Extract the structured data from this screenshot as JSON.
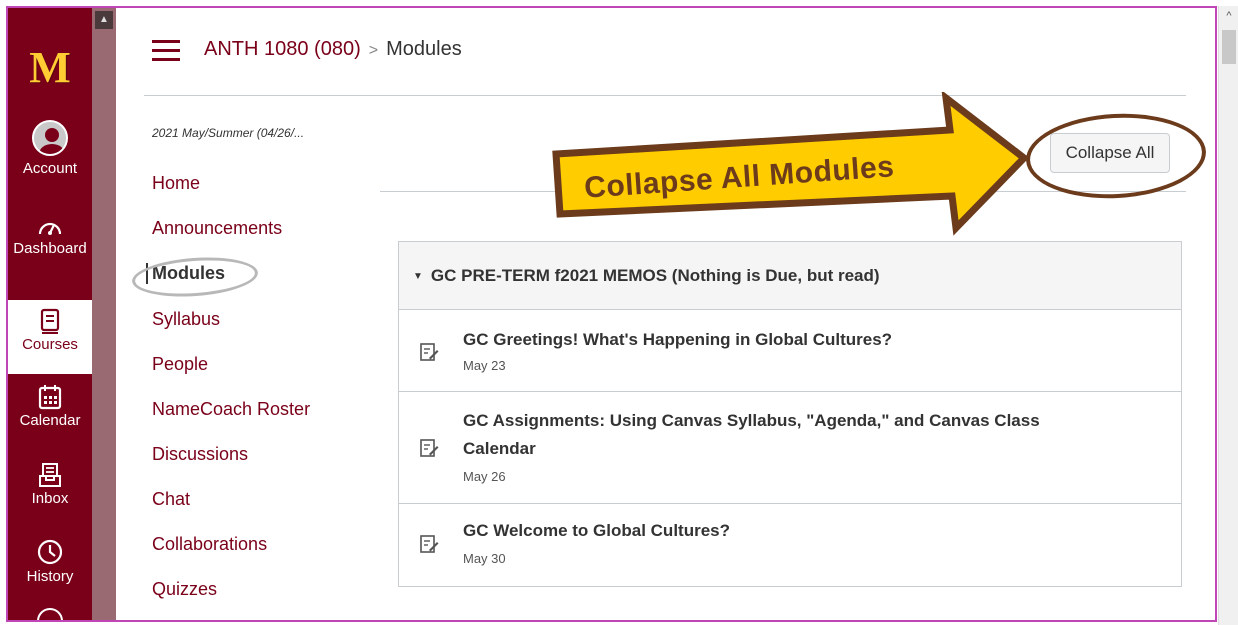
{
  "global_nav": {
    "logo": "M",
    "items": [
      {
        "label": "Account",
        "icon": "user-avatar-icon"
      },
      {
        "label": "Dashboard",
        "icon": "dashboard-gauge-icon"
      },
      {
        "label": "Courses",
        "icon": "courses-book-icon"
      },
      {
        "label": "Calendar",
        "icon": "calendar-icon"
      },
      {
        "label": "Inbox",
        "icon": "inbox-icon"
      },
      {
        "label": "History",
        "icon": "history-clock-icon"
      }
    ]
  },
  "breadcrumb": {
    "course": "ANTH 1080 (080)",
    "separator": ">",
    "current": "Modules"
  },
  "course_nav": {
    "term": "2021 May/Summer (04/26/...",
    "items": [
      "Home",
      "Announcements",
      "Modules",
      "Syllabus",
      "People",
      "NameCoach Roster",
      "Discussions",
      "Chat",
      "Collaborations",
      "Quizzes"
    ],
    "active": "Modules"
  },
  "toolbar": {
    "collapse_all_label": "Collapse All"
  },
  "callout": {
    "text": "Collapse All Modules",
    "fill_color": "#ffcc00",
    "border_color": "#6b3b1c"
  },
  "module": {
    "title": "GC PRE-TERM f2021 MEMOS (Nothing is Due, but read)",
    "items": [
      {
        "title": "GC Greetings! What's Happening in Global Cultures?",
        "date": "May 23"
      },
      {
        "title_line1": "GC Assignments: Using Canvas Syllabus, \"Agenda,\" and Canvas Class",
        "title_line2": "Calendar",
        "date": "May 26"
      },
      {
        "title": "GC Welcome to Global Cultures?",
        "date": "May 30"
      }
    ]
  },
  "colors": {
    "brand_maroon": "#7a0019",
    "brand_gold": "#ffcc33",
    "frame_magenta": "#c046b8"
  }
}
